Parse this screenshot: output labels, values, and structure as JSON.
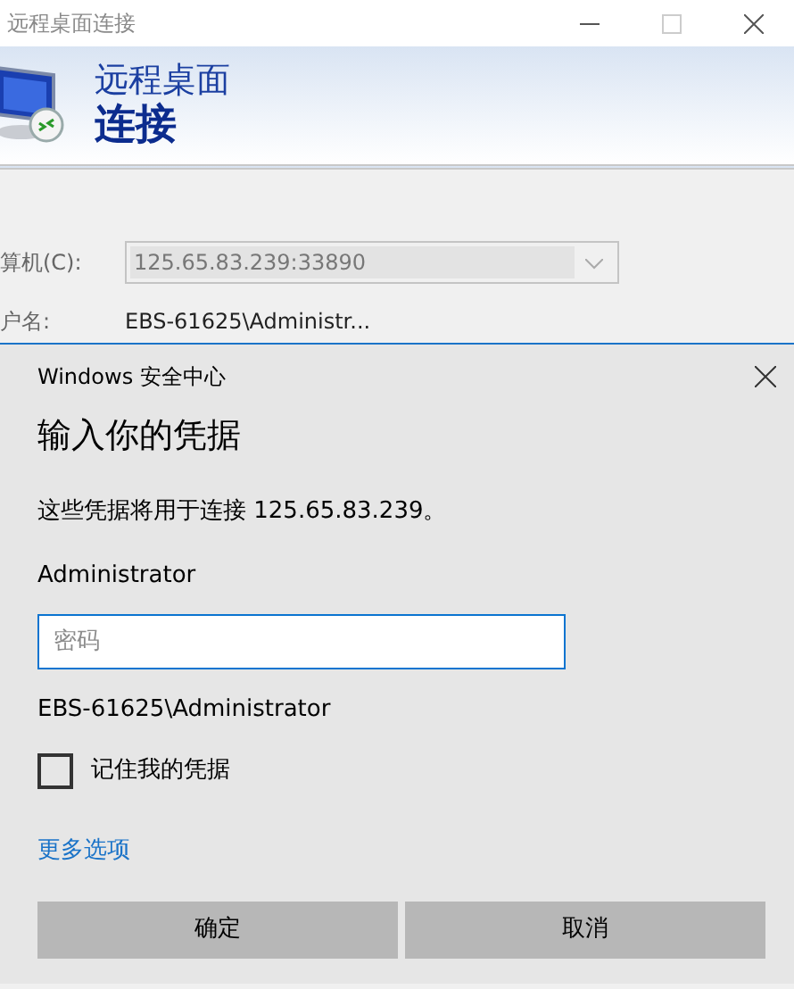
{
  "window": {
    "title": "远程桌面连接"
  },
  "banner": {
    "line1": "远程桌面",
    "line2": "连接"
  },
  "form": {
    "fields": [
      {
        "label": "算机(C):",
        "value": "125.65.83.239:33890",
        "kind": "combo"
      },
      {
        "label": "户名:",
        "value": "EBS-61625\\Administr...",
        "kind": "text"
      }
    ]
  },
  "dialog": {
    "app": "Windows 安全中心",
    "heading": "输入你的凭据",
    "message": "这些凭据将用于连接 125.65.83.239。",
    "username": "Administrator",
    "password": {
      "placeholder": "密码"
    },
    "account": "EBS-61625\\Administrator",
    "remember": {
      "label": "记住我的凭据",
      "checked": false
    },
    "more_link": "更多选项",
    "buttons": [
      "确定",
      "取消"
    ]
  }
}
